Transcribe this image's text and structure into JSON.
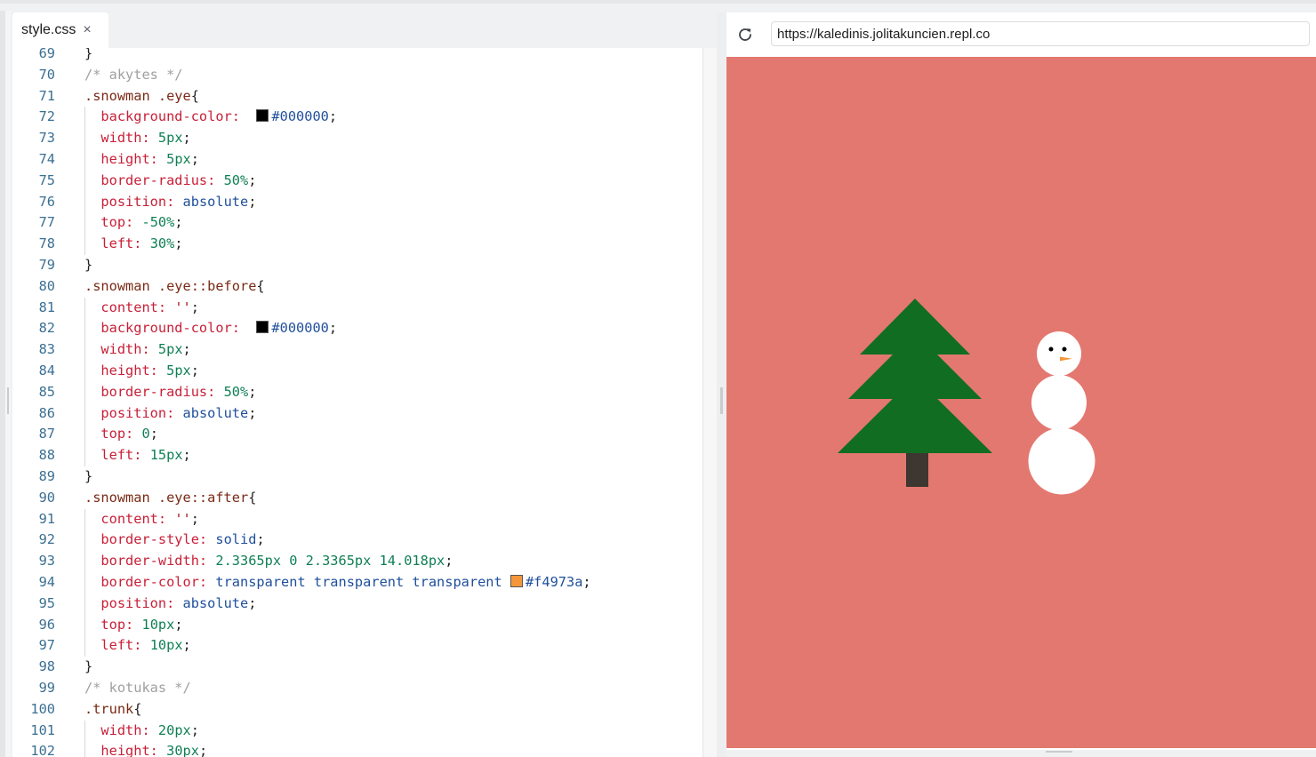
{
  "editor": {
    "tab_label": "style.css",
    "tab_close": "×",
    "lines": [
      {
        "n": "69",
        "tokens": [
          [
            "brace",
            "}"
          ]
        ]
      },
      {
        "n": "70",
        "tokens": [
          [
            "com",
            "/* akytes */"
          ]
        ]
      },
      {
        "n": "71",
        "tokens": [
          [
            "sel",
            ".snowman .eye"
          ],
          [
            "brace",
            "{"
          ]
        ]
      },
      {
        "n": "72",
        "indent": true,
        "tokens": [
          [
            "prop",
            "background-color:"
          ],
          [
            "punc",
            "  "
          ],
          [
            "swatch",
            "#000000"
          ],
          [
            "hex",
            "#000000"
          ],
          [
            "punc",
            ";"
          ]
        ]
      },
      {
        "n": "73",
        "indent": true,
        "tokens": [
          [
            "prop",
            "width:"
          ],
          [
            "punc",
            " "
          ],
          [
            "num",
            "5px"
          ],
          [
            "punc",
            ";"
          ]
        ]
      },
      {
        "n": "74",
        "indent": true,
        "tokens": [
          [
            "prop",
            "height:"
          ],
          [
            "punc",
            " "
          ],
          [
            "num",
            "5px"
          ],
          [
            "punc",
            ";"
          ]
        ]
      },
      {
        "n": "75",
        "indent": true,
        "tokens": [
          [
            "prop",
            "border-radius:"
          ],
          [
            "punc",
            " "
          ],
          [
            "num",
            "50%"
          ],
          [
            "punc",
            ";"
          ]
        ]
      },
      {
        "n": "76",
        "indent": true,
        "tokens": [
          [
            "prop",
            "position:"
          ],
          [
            "punc",
            " "
          ],
          [
            "kw",
            "absolute"
          ],
          [
            "punc",
            ";"
          ]
        ]
      },
      {
        "n": "77",
        "indent": true,
        "tokens": [
          [
            "prop",
            "top:"
          ],
          [
            "punc",
            " "
          ],
          [
            "num",
            "-50%"
          ],
          [
            "punc",
            ";"
          ]
        ]
      },
      {
        "n": "78",
        "indent": true,
        "tokens": [
          [
            "prop",
            "left:"
          ],
          [
            "punc",
            " "
          ],
          [
            "num",
            "30%"
          ],
          [
            "punc",
            ";"
          ]
        ]
      },
      {
        "n": "79",
        "tokens": [
          [
            "brace",
            "}"
          ]
        ]
      },
      {
        "n": "80",
        "tokens": [
          [
            "sel",
            ".snowman .eye::before"
          ],
          [
            "brace",
            "{"
          ]
        ]
      },
      {
        "n": "81",
        "indent": true,
        "tokens": [
          [
            "prop",
            "content:"
          ],
          [
            "punc",
            " "
          ],
          [
            "str",
            "''"
          ],
          [
            "punc",
            ";"
          ]
        ]
      },
      {
        "n": "82",
        "indent": true,
        "tokens": [
          [
            "prop",
            "background-color:"
          ],
          [
            "punc",
            "  "
          ],
          [
            "swatch",
            "#000000"
          ],
          [
            "hex",
            "#000000"
          ],
          [
            "punc",
            ";"
          ]
        ]
      },
      {
        "n": "83",
        "indent": true,
        "tokens": [
          [
            "prop",
            "width:"
          ],
          [
            "punc",
            " "
          ],
          [
            "num",
            "5px"
          ],
          [
            "punc",
            ";"
          ]
        ]
      },
      {
        "n": "84",
        "indent": true,
        "tokens": [
          [
            "prop",
            "height:"
          ],
          [
            "punc",
            " "
          ],
          [
            "num",
            "5px"
          ],
          [
            "punc",
            ";"
          ]
        ]
      },
      {
        "n": "85",
        "indent": true,
        "tokens": [
          [
            "prop",
            "border-radius:"
          ],
          [
            "punc",
            " "
          ],
          [
            "num",
            "50%"
          ],
          [
            "punc",
            ";"
          ]
        ]
      },
      {
        "n": "86",
        "indent": true,
        "tokens": [
          [
            "prop",
            "position:"
          ],
          [
            "punc",
            " "
          ],
          [
            "kw",
            "absolute"
          ],
          [
            "punc",
            ";"
          ]
        ]
      },
      {
        "n": "87",
        "indent": true,
        "tokens": [
          [
            "prop",
            "top:"
          ],
          [
            "punc",
            " "
          ],
          [
            "num",
            "0"
          ],
          [
            "punc",
            ";"
          ]
        ]
      },
      {
        "n": "88",
        "indent": true,
        "tokens": [
          [
            "prop",
            "left:"
          ],
          [
            "punc",
            " "
          ],
          [
            "num",
            "15px"
          ],
          [
            "punc",
            ";"
          ]
        ]
      },
      {
        "n": "89",
        "tokens": [
          [
            "brace",
            "}"
          ]
        ]
      },
      {
        "n": "90",
        "tokens": [
          [
            "sel",
            ".snowman .eye::after"
          ],
          [
            "brace",
            "{"
          ]
        ]
      },
      {
        "n": "91",
        "indent": true,
        "tokens": [
          [
            "prop",
            "content:"
          ],
          [
            "punc",
            " "
          ],
          [
            "str",
            "''"
          ],
          [
            "punc",
            ";"
          ]
        ]
      },
      {
        "n": "92",
        "indent": true,
        "tokens": [
          [
            "prop",
            "border-style:"
          ],
          [
            "punc",
            " "
          ],
          [
            "kw",
            "solid"
          ],
          [
            "punc",
            ";"
          ]
        ]
      },
      {
        "n": "93",
        "indent": true,
        "tokens": [
          [
            "prop",
            "border-width:"
          ],
          [
            "punc",
            " "
          ],
          [
            "num",
            "2.3365px 0 2.3365px 14.018px"
          ],
          [
            "punc",
            ";"
          ]
        ]
      },
      {
        "n": "94",
        "indent": true,
        "tokens": [
          [
            "prop",
            "border-color:"
          ],
          [
            "punc",
            " "
          ],
          [
            "kw",
            "transparent transparent transparent"
          ],
          [
            "punc",
            " "
          ],
          [
            "swatch",
            "#f4973a"
          ],
          [
            "hex",
            "#f4973a"
          ],
          [
            "punc",
            ";"
          ]
        ]
      },
      {
        "n": "95",
        "indent": true,
        "tokens": [
          [
            "prop",
            "position:"
          ],
          [
            "punc",
            " "
          ],
          [
            "kw",
            "absolute"
          ],
          [
            "punc",
            ";"
          ]
        ]
      },
      {
        "n": "96",
        "indent": true,
        "tokens": [
          [
            "prop",
            "top:"
          ],
          [
            "punc",
            " "
          ],
          [
            "num",
            "10px"
          ],
          [
            "punc",
            ";"
          ]
        ]
      },
      {
        "n": "97",
        "indent": true,
        "tokens": [
          [
            "prop",
            "left:"
          ],
          [
            "punc",
            " "
          ],
          [
            "num",
            "10px"
          ],
          [
            "punc",
            ";"
          ]
        ]
      },
      {
        "n": "98",
        "tokens": [
          [
            "brace",
            "}"
          ]
        ]
      },
      {
        "n": "99",
        "tokens": [
          [
            "com",
            "/* kotukas */"
          ]
        ]
      },
      {
        "n": "100",
        "tokens": [
          [
            "sel",
            ".trunk"
          ],
          [
            "brace",
            "{"
          ]
        ]
      },
      {
        "n": "101",
        "indent": true,
        "tokens": [
          [
            "prop",
            "width:"
          ],
          [
            "punc",
            " "
          ],
          [
            "num",
            "20px"
          ],
          [
            "punc",
            ";"
          ]
        ]
      },
      {
        "n": "102",
        "indent": true,
        "tokens": [
          [
            "prop",
            "height:"
          ],
          [
            "punc",
            " "
          ],
          [
            "num",
            "30px"
          ],
          [
            "punc",
            ";"
          ]
        ]
      }
    ]
  },
  "browser": {
    "url": "https://kaledinis.jolitakuncien.repl.co",
    "reload_icon": "reload-icon",
    "viewport_bg": "#e37870",
    "scene": {
      "tree_color": "#116d22",
      "trunk_color": "#3e3630",
      "snow_color": "#ffffff",
      "eye_color": "#000000",
      "nose_color": "#f4973a"
    }
  }
}
